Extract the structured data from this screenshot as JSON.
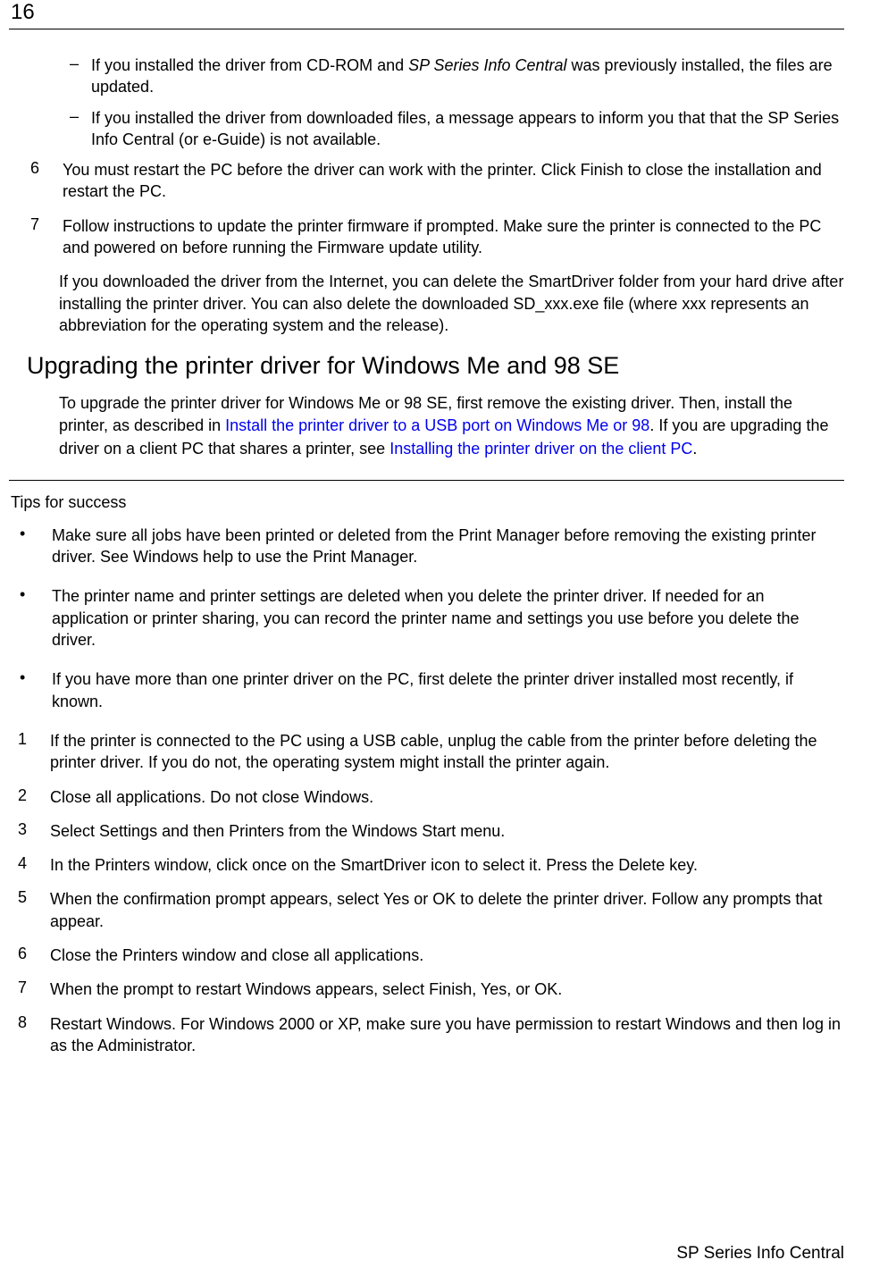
{
  "page_number": "16",
  "sub_items": [
    {
      "pre": "If you installed the driver from CD-ROM and ",
      "italic": "SP Series Info Central",
      "post": " was previously installed, the files are updated."
    },
    {
      "text": "If you installed the driver from downloaded files, a message appears to inform you that that the SP Series Info Central (or e-Guide) is not available."
    }
  ],
  "ol_a": [
    {
      "n": "6",
      "text": "You must restart the PC before the driver can work with the printer. Click Finish to close the installation and restart the PC."
    },
    {
      "n": "7",
      "text": "Follow instructions to update the printer firmware if prompted. Make sure the printer is connected to the PC and powered on before running the Firmware update utility."
    }
  ],
  "para_post_ol": "If you downloaded the driver from the Internet, you can delete the SmartDriver folder from your hard drive after installing the printer driver. You can also delete the downloaded SD_xxx.exe file (where xxx represents an abbreviation for the operating system and the release).",
  "h2": "Upgrading the printer driver for Windows Me and 98 SE",
  "h2_para": {
    "t1": "To upgrade the printer driver for Windows Me or 98 SE, first remove the existing driver. Then, install the printer, as described in ",
    "link1": "Install the printer driver to a USB port on Windows Me or 98",
    "t2": ". If you are upgrading the driver on a client PC that shares a printer, see ",
    "link2": "Installing the printer driver on the client PC",
    "t3": "."
  },
  "tips_title": "Tips for success",
  "bullets": [
    "Make sure all jobs have been printed or deleted from the Print Manager before removing the existing printer driver. See Windows help to use the Print Manager.",
    "The printer name and printer settings are deleted when you delete the printer driver. If needed for an application or printer sharing, you can record the printer name and settings you use before you delete the driver.",
    "If you have more than one printer driver on the PC, first delete the printer driver installed most recently, if known."
  ],
  "ol_b": [
    {
      "n": "1",
      "text": "If the printer is connected to the PC using a USB cable, unplug the cable from the printer before deleting the printer driver. If you do not, the operating system might install the printer again."
    },
    {
      "n": "2",
      "text": "Close all applications. Do not close Windows."
    },
    {
      "n": "3",
      "text": "Select Settings and then Printers from the Windows Start menu."
    },
    {
      "n": "4",
      "text": "In the Printers window, click once on the SmartDriver icon to select it. Press the Delete key."
    },
    {
      "n": "5",
      "text": "When the confirmation prompt appears, select Yes or OK to delete the printer driver. Follow any prompts that appear."
    },
    {
      "n": "6",
      "text": "Close the Printers window and close all applications."
    },
    {
      "n": "7",
      "text": "When the prompt to restart Windows appears, select Finish, Yes, or OK."
    },
    {
      "n": "8",
      "text": "Restart Windows. For Windows 2000 or XP, make sure you have permission to restart Windows and then log in as the Administrator."
    }
  ],
  "footer": "SP Series Info Central"
}
